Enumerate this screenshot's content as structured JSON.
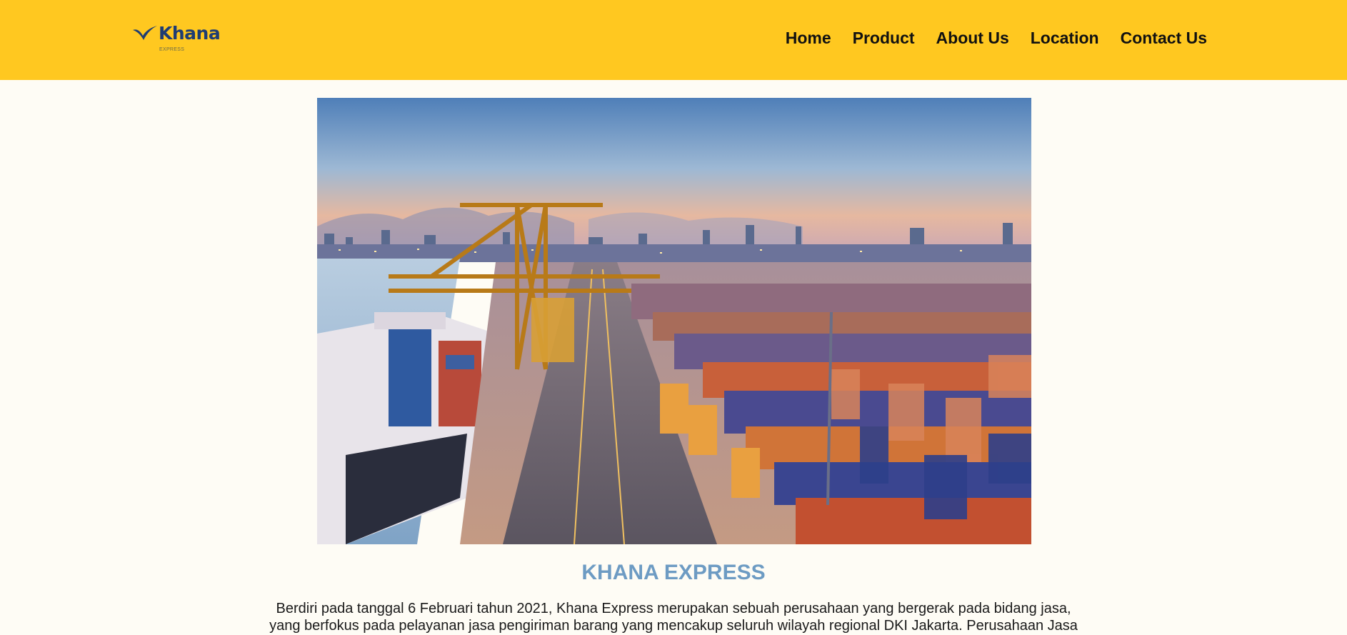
{
  "header": {
    "logo": {
      "name": "Khana",
      "tagline": "EXPRESS"
    },
    "nav": [
      {
        "label": "Home"
      },
      {
        "label": "Product"
      },
      {
        "label": "About Us"
      },
      {
        "label": "Location"
      },
      {
        "label": "Contact Us"
      }
    ]
  },
  "main": {
    "hero_image": "container-port-photo",
    "title": "KHANA EXPRESS",
    "description": "Berdiri pada tanggal 6 Februari tahun 2021, Khana Express merupakan sebuah perusahaan yang bergerak pada bidang jasa, yang berfokus pada pelayanan jasa pengiriman barang yang mencakup seluruh wilayah regional DKI Jakarta. Perusahaan Jasa"
  },
  "colors": {
    "header_bg": "#ffc820",
    "page_bg": "#fefcf5",
    "title": "#6d9bc3",
    "logo": "#1f3d73"
  }
}
